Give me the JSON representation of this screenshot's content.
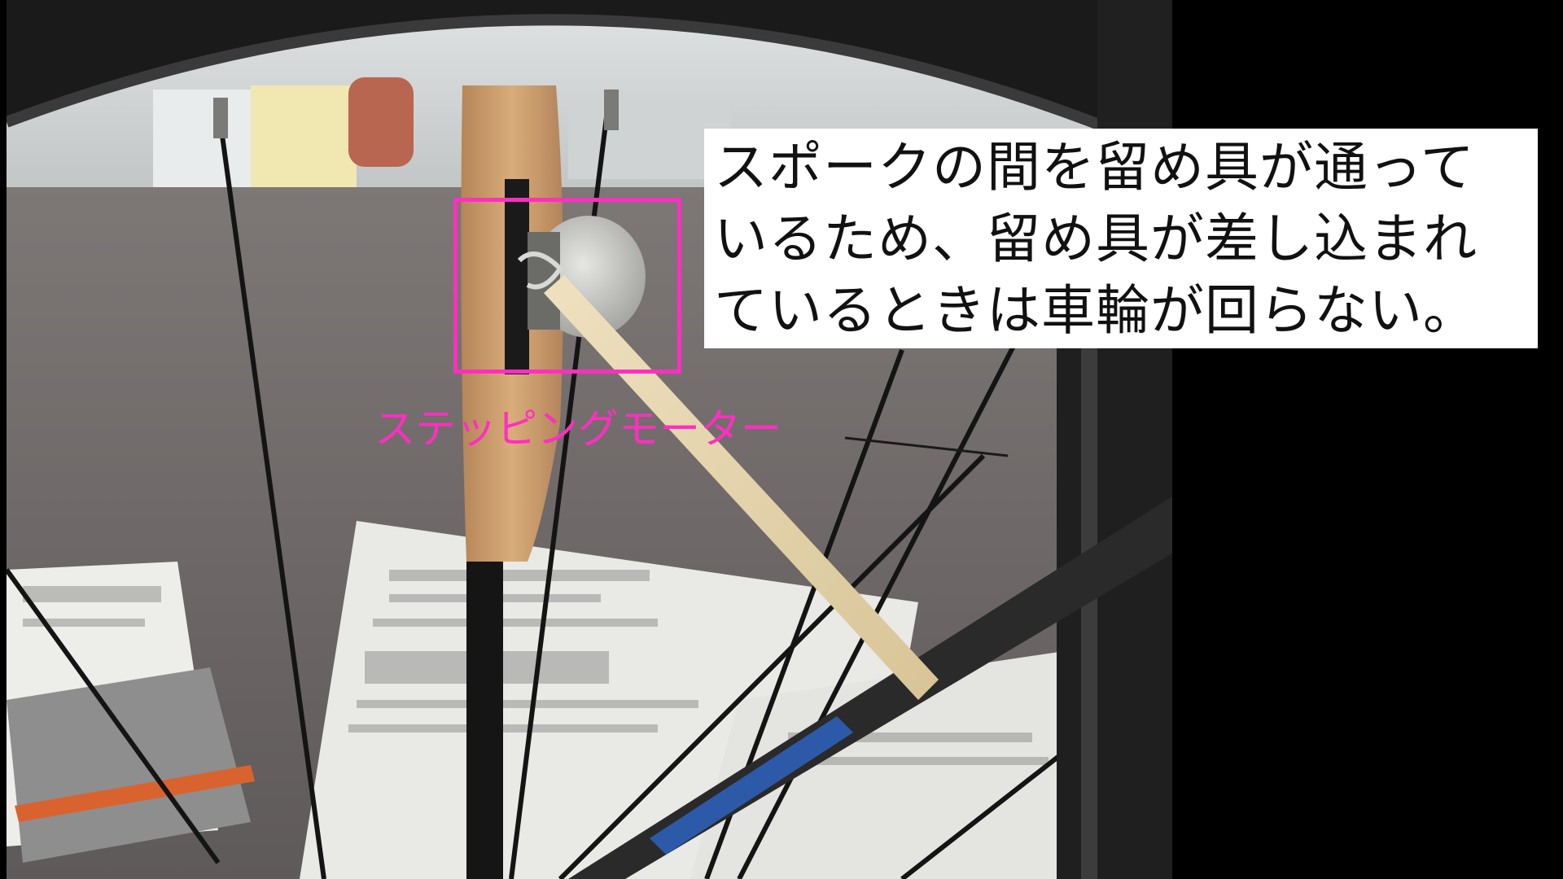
{
  "caption": {
    "lines": [
      "スポークの間を留め具が通って",
      "いるため、留め具が差し込まれ",
      "ているときは車輪が回らない。"
    ]
  },
  "annotation": {
    "label": "ステッピングモーター",
    "color": "#ff2fc0"
  },
  "photo": {
    "subject": "bicycle-wheel-lock-mechanism"
  }
}
